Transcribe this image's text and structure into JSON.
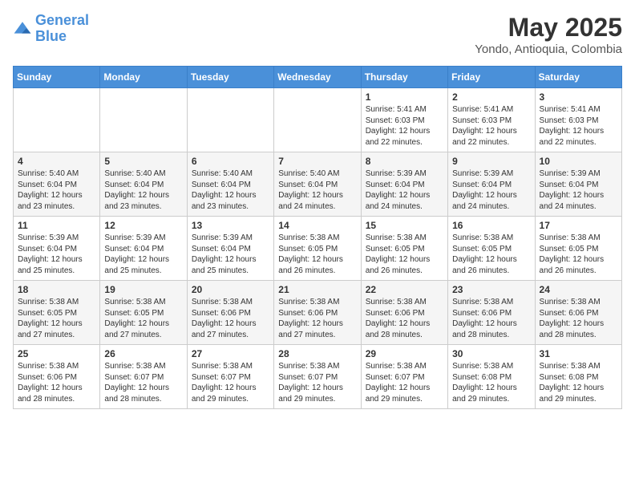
{
  "header": {
    "logo_line1": "General",
    "logo_line2": "Blue",
    "title": "May 2025",
    "subtitle": "Yondo, Antioquia, Colombia"
  },
  "weekdays": [
    "Sunday",
    "Monday",
    "Tuesday",
    "Wednesday",
    "Thursday",
    "Friday",
    "Saturday"
  ],
  "weeks": [
    [
      {
        "day": "",
        "info": ""
      },
      {
        "day": "",
        "info": ""
      },
      {
        "day": "",
        "info": ""
      },
      {
        "day": "",
        "info": ""
      },
      {
        "day": "1",
        "info": "Sunrise: 5:41 AM\nSunset: 6:03 PM\nDaylight: 12 hours\nand 22 minutes."
      },
      {
        "day": "2",
        "info": "Sunrise: 5:41 AM\nSunset: 6:03 PM\nDaylight: 12 hours\nand 22 minutes."
      },
      {
        "day": "3",
        "info": "Sunrise: 5:41 AM\nSunset: 6:03 PM\nDaylight: 12 hours\nand 22 minutes."
      }
    ],
    [
      {
        "day": "4",
        "info": "Sunrise: 5:40 AM\nSunset: 6:04 PM\nDaylight: 12 hours\nand 23 minutes."
      },
      {
        "day": "5",
        "info": "Sunrise: 5:40 AM\nSunset: 6:04 PM\nDaylight: 12 hours\nand 23 minutes."
      },
      {
        "day": "6",
        "info": "Sunrise: 5:40 AM\nSunset: 6:04 PM\nDaylight: 12 hours\nand 23 minutes."
      },
      {
        "day": "7",
        "info": "Sunrise: 5:40 AM\nSunset: 6:04 PM\nDaylight: 12 hours\nand 24 minutes."
      },
      {
        "day": "8",
        "info": "Sunrise: 5:39 AM\nSunset: 6:04 PM\nDaylight: 12 hours\nand 24 minutes."
      },
      {
        "day": "9",
        "info": "Sunrise: 5:39 AM\nSunset: 6:04 PM\nDaylight: 12 hours\nand 24 minutes."
      },
      {
        "day": "10",
        "info": "Sunrise: 5:39 AM\nSunset: 6:04 PM\nDaylight: 12 hours\nand 24 minutes."
      }
    ],
    [
      {
        "day": "11",
        "info": "Sunrise: 5:39 AM\nSunset: 6:04 PM\nDaylight: 12 hours\nand 25 minutes."
      },
      {
        "day": "12",
        "info": "Sunrise: 5:39 AM\nSunset: 6:04 PM\nDaylight: 12 hours\nand 25 minutes."
      },
      {
        "day": "13",
        "info": "Sunrise: 5:39 AM\nSunset: 6:04 PM\nDaylight: 12 hours\nand 25 minutes."
      },
      {
        "day": "14",
        "info": "Sunrise: 5:38 AM\nSunset: 6:05 PM\nDaylight: 12 hours\nand 26 minutes."
      },
      {
        "day": "15",
        "info": "Sunrise: 5:38 AM\nSunset: 6:05 PM\nDaylight: 12 hours\nand 26 minutes."
      },
      {
        "day": "16",
        "info": "Sunrise: 5:38 AM\nSunset: 6:05 PM\nDaylight: 12 hours\nand 26 minutes."
      },
      {
        "day": "17",
        "info": "Sunrise: 5:38 AM\nSunset: 6:05 PM\nDaylight: 12 hours\nand 26 minutes."
      }
    ],
    [
      {
        "day": "18",
        "info": "Sunrise: 5:38 AM\nSunset: 6:05 PM\nDaylight: 12 hours\nand 27 minutes."
      },
      {
        "day": "19",
        "info": "Sunrise: 5:38 AM\nSunset: 6:05 PM\nDaylight: 12 hours\nand 27 minutes."
      },
      {
        "day": "20",
        "info": "Sunrise: 5:38 AM\nSunset: 6:06 PM\nDaylight: 12 hours\nand 27 minutes."
      },
      {
        "day": "21",
        "info": "Sunrise: 5:38 AM\nSunset: 6:06 PM\nDaylight: 12 hours\nand 27 minutes."
      },
      {
        "day": "22",
        "info": "Sunrise: 5:38 AM\nSunset: 6:06 PM\nDaylight: 12 hours\nand 28 minutes."
      },
      {
        "day": "23",
        "info": "Sunrise: 5:38 AM\nSunset: 6:06 PM\nDaylight: 12 hours\nand 28 minutes."
      },
      {
        "day": "24",
        "info": "Sunrise: 5:38 AM\nSunset: 6:06 PM\nDaylight: 12 hours\nand 28 minutes."
      }
    ],
    [
      {
        "day": "25",
        "info": "Sunrise: 5:38 AM\nSunset: 6:06 PM\nDaylight: 12 hours\nand 28 minutes."
      },
      {
        "day": "26",
        "info": "Sunrise: 5:38 AM\nSunset: 6:07 PM\nDaylight: 12 hours\nand 28 minutes."
      },
      {
        "day": "27",
        "info": "Sunrise: 5:38 AM\nSunset: 6:07 PM\nDaylight: 12 hours\nand 29 minutes."
      },
      {
        "day": "28",
        "info": "Sunrise: 5:38 AM\nSunset: 6:07 PM\nDaylight: 12 hours\nand 29 minutes."
      },
      {
        "day": "29",
        "info": "Sunrise: 5:38 AM\nSunset: 6:07 PM\nDaylight: 12 hours\nand 29 minutes."
      },
      {
        "day": "30",
        "info": "Sunrise: 5:38 AM\nSunset: 6:08 PM\nDaylight: 12 hours\nand 29 minutes."
      },
      {
        "day": "31",
        "info": "Sunrise: 5:38 AM\nSunset: 6:08 PM\nDaylight: 12 hours\nand 29 minutes."
      }
    ]
  ]
}
